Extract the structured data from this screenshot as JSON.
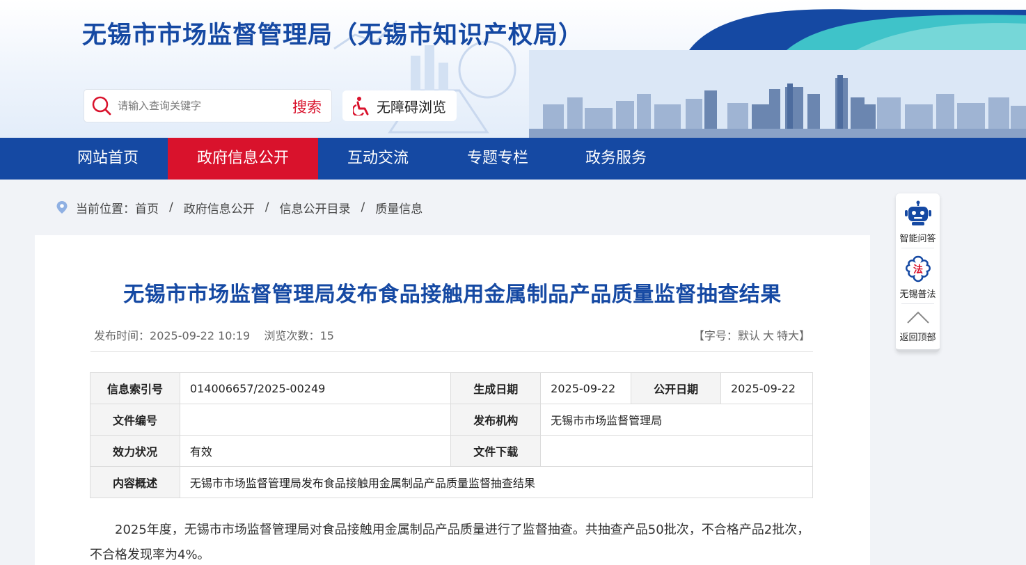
{
  "header": {
    "site_title": "无锡市市场监督管理局（无锡市知识产权局）",
    "search": {
      "placeholder": "请输入查询关键字",
      "button_label": "搜索"
    },
    "accessibility_label": "无障碍浏览"
  },
  "nav": {
    "items": [
      {
        "label": "网站首页"
      },
      {
        "label": "政府信息公开",
        "active": true
      },
      {
        "label": "互动交流"
      },
      {
        "label": "专题专栏"
      },
      {
        "label": "政务服务"
      }
    ]
  },
  "breadcrumb": {
    "prefix": "当前位置：",
    "items": [
      "首页",
      "政府信息公开",
      "信息公开目录",
      "质量信息"
    ],
    "separator": "/"
  },
  "sidebar": {
    "items": [
      {
        "label": "智能问答",
        "icon": "robot-icon"
      },
      {
        "label": "无锡普法",
        "icon": "law-icon"
      },
      {
        "label": "返回顶部",
        "icon": "chevron-up-icon"
      }
    ]
  },
  "article": {
    "title": "无锡市市场监督管理局发布食品接触用金属制品产品质量监督抽查结果",
    "publish_label": "发布时间：",
    "publish_time": "2025-09-22 10:19",
    "views_label": "浏览次数：",
    "views": "15",
    "font_size": {
      "prefix": "【字号：",
      "options": [
        "默认",
        "大",
        "特大"
      ],
      "suffix": "】"
    },
    "info": {
      "index_label": "信息索引号",
      "index_value": "014006657/2025-00249",
      "created_label": "生成日期",
      "created_value": "2025-09-22",
      "public_label": "公开日期",
      "public_value": "2025-09-22",
      "doc_no_label": "文件编号",
      "doc_no_value": "",
      "issuer_label": "发布机构",
      "issuer_value": "无锡市市场监督管理局",
      "status_label": "效力状况",
      "status_value": "有效",
      "download_label": "文件下载",
      "download_value": "",
      "summary_label": "内容概述",
      "summary_value": "无锡市市场监督管理局发布食品接触用金属制品产品质量监督抽查结果"
    },
    "body": "2025年度，无锡市市场监督管理局对食品接触用金属制品产品质量进行了监督抽查。共抽查产品50批次，不合格产品2批次，不合格发现率为4%。"
  },
  "colors": {
    "primary": "#1549a3",
    "accent": "#d9122c"
  }
}
